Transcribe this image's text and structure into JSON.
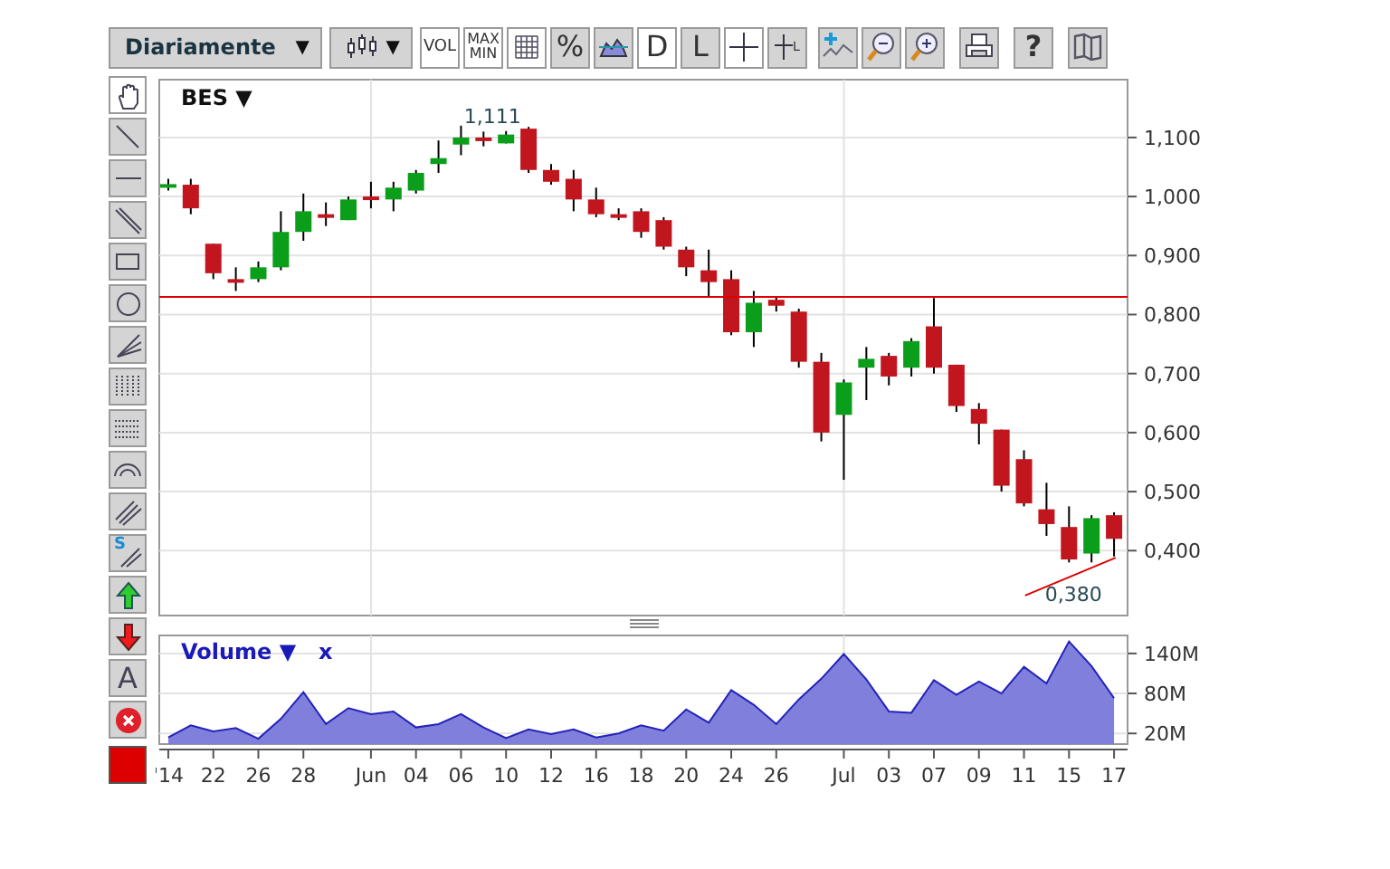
{
  "toolbar": {
    "period": {
      "label": "Diariamente",
      "caret": "▼"
    },
    "chart_type": {
      "caret": "▼"
    },
    "buttons": [
      {
        "kind": "vol",
        "label": "VOL",
        "selected": true
      },
      {
        "kind": "maxmin",
        "label": "MAX MIN",
        "selected": true
      },
      {
        "kind": "grid",
        "selected": true
      },
      {
        "kind": "percent",
        "label": "%",
        "selected": false
      },
      {
        "kind": "area",
        "selected": false
      },
      {
        "kind": "d",
        "label": "D",
        "selected": true
      },
      {
        "kind": "l",
        "label": "L",
        "selected": false
      },
      {
        "kind": "crosshair",
        "selected": true
      },
      {
        "kind": "crosshair_l",
        "label": "L",
        "selected": false
      },
      {
        "kind": "indicator",
        "selected": false
      },
      {
        "kind": "zoom_out",
        "selected": false
      },
      {
        "kind": "zoom_in",
        "selected": false
      },
      {
        "kind": "print",
        "selected": false
      },
      {
        "kind": "help",
        "label": "?",
        "selected": false
      },
      {
        "kind": "book",
        "selected": false
      }
    ]
  },
  "tools": [
    {
      "kind": "pan",
      "selected": true
    },
    {
      "kind": "line",
      "selected": false
    },
    {
      "kind": "hline",
      "selected": false
    },
    {
      "kind": "parallel",
      "selected": false
    },
    {
      "kind": "rect",
      "selected": false
    },
    {
      "kind": "circle",
      "selected": false
    },
    {
      "kind": "fan",
      "selected": false
    },
    {
      "kind": "vgrid",
      "selected": false
    },
    {
      "kind": "hgrid",
      "selected": false
    },
    {
      "kind": "arcs",
      "selected": false
    },
    {
      "kind": "channel",
      "selected": false
    },
    {
      "kind": "schannel",
      "label": "S",
      "selected": false
    },
    {
      "kind": "arrow_up",
      "selected": false
    },
    {
      "kind": "arrow_down",
      "selected": false
    },
    {
      "kind": "text",
      "label": "A",
      "selected": false
    },
    {
      "kind": "delete",
      "selected": false
    }
  ],
  "color_swatch": {
    "color": "#dd0000"
  },
  "price_chart": {
    "symbol": "BES",
    "caret": "▼",
    "max_label": "1,111",
    "min_label": "0,380",
    "axis_labels": [
      "1,100",
      "1,000",
      "0,900",
      "0,800",
      "0,700",
      "0,600",
      "0,500",
      "0,400"
    ]
  },
  "volume_chart": {
    "caret": "▼",
    "close": "x",
    "chart_data": {
      "type": "area",
      "grid": true,
      "categories": [
        "'14",
        null,
        "22",
        null,
        "26",
        null,
        "28",
        null,
        null,
        "Jun",
        null,
        "04",
        null,
        "06",
        null,
        "10",
        null,
        "12",
        null,
        "16",
        null,
        "18",
        null,
        "20",
        null,
        "24",
        null,
        "26",
        null,
        null,
        "Jul",
        null,
        "03",
        null,
        "07",
        null,
        "09",
        null,
        "11",
        null,
        "15",
        null,
        "17"
      ],
      "ylim": [
        4,
        167
      ],
      "yticks": [
        {
          "value": 20,
          "label": "20M"
        },
        {
          "value": 80,
          "label": "80M"
        },
        {
          "value": 140,
          "label": "140M"
        }
      ],
      "series": [
        {
          "name": "Volume",
          "color": "#8080dc",
          "values": [
            14,
            32,
            23,
            28,
            12,
            42,
            82,
            34,
            58,
            49,
            53,
            29,
            34,
            49,
            29,
            13,
            26,
            19,
            26,
            14,
            20,
            32,
            24,
            56,
            36,
            85,
            63,
            34,
            71,
            102,
            139,
            101,
            53,
            51,
            100,
            78,
            98,
            80,
            120,
            95,
            158,
            121,
            73
          ]
        }
      ]
    }
  }
}
